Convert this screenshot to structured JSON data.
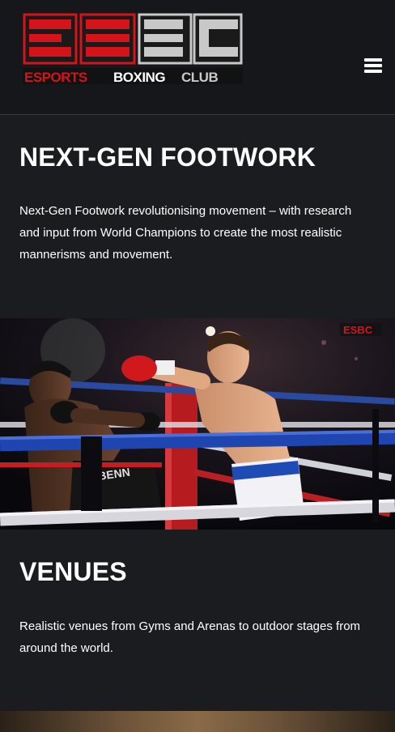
{
  "header": {
    "logo_text": "ESBC",
    "logo_subtext": "ESPORTSBOXINGCLUB",
    "menu_icon": "hamburger-menu-icon"
  },
  "sections": [
    {
      "title": "NEXT-GEN FOOTWORK",
      "body": "Next-Gen Footwork revolutionising movement – with research and input from World Champions to create the most realistic mannerisms and movement."
    },
    {
      "title": "VENUES",
      "body": "Realistic venues from Gyms and Arenas to outdoor stages from around the world."
    }
  ],
  "hero_image": {
    "description_icon": "boxing-match-image",
    "trunk_text_left": "BENN",
    "watermark": "ESBC"
  },
  "colors": {
    "background": "#1b1c1f",
    "header_bg": "#16171a",
    "logo_red": "#d4141a",
    "logo_silver": "#c8c8c8"
  }
}
